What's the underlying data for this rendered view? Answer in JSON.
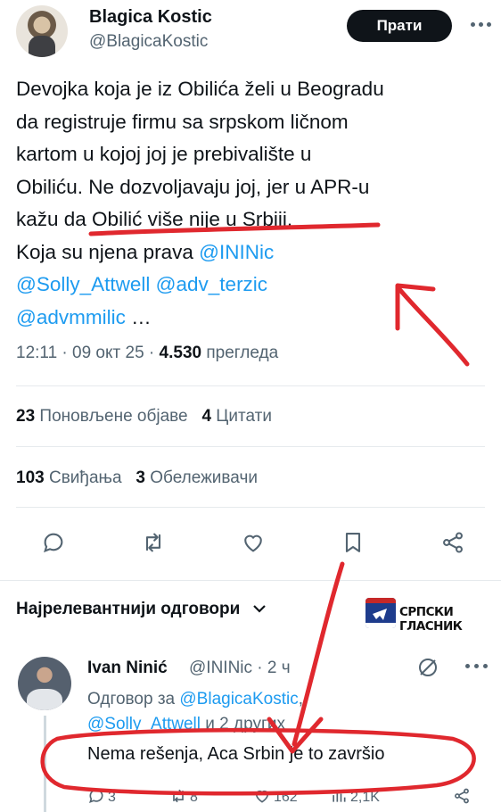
{
  "author": {
    "name": "Blagica Kostic",
    "handle": "@BlagicaKostic",
    "follow_label": "Прати"
  },
  "tweet": {
    "line1": "Devojka koja je iz Obilića želi u Beogradu",
    "line2": "da registruje firmu sa srpskom ličnom",
    "line3": "kartom u kojoj joj je  prebivalište u",
    "line4": "Obiliću. Ne dozvoljavaju joj, jer u APR-u",
    "line5": "kažu da Obilić više nije u Srbiji.",
    "line6_prefix": "Koja su njena prava ",
    "mention1": "@ININic",
    "mention2": "@Solly_Attwell",
    "mention3": "@adv_terzic",
    "mention4": "@advmmilic",
    "ellipsis": " …"
  },
  "meta": {
    "time": "12:11 · 09 окт 25 · ",
    "views_count": "4.530",
    "views_label": " прегледа"
  },
  "stats": {
    "reposts_count": "23",
    "reposts_label": " Поновљене објаве",
    "quotes_count": "4",
    "quotes_label": " Цитати",
    "likes_count": "103",
    "likes_label": " Свиђања",
    "bookmarks_count": "3",
    "bookmarks_label": " Обележивачи"
  },
  "icons": {
    "reply": "reply-icon",
    "repost": "repost-icon",
    "like": "heart-icon",
    "bookmark": "bookmark-icon",
    "share": "share-icon"
  },
  "replies_header": {
    "label": "Најрелевантнији одговори",
    "chevron": "⌄"
  },
  "watermark": {
    "label": "СРПСКИ ГЛАСНИК"
  },
  "reply": {
    "name": "Ivan Ninić",
    "handle_time": "@ININic · 2 ч",
    "to_prefix": "Одговор за ",
    "to_mention1": "@BlagicaKostic",
    "to_mention2": "@Solly_Attwell",
    "to_suffix": " и 2 других",
    "text": "Nema rešenja, Aca Srbin je to završio",
    "replies": "3",
    "reposts": "8",
    "likes": "162",
    "views": "2,1K"
  },
  "colors": {
    "accent": "#1d9bf0",
    "annotation": "#e0282e",
    "text": "#0f1419",
    "muted": "#536471"
  }
}
